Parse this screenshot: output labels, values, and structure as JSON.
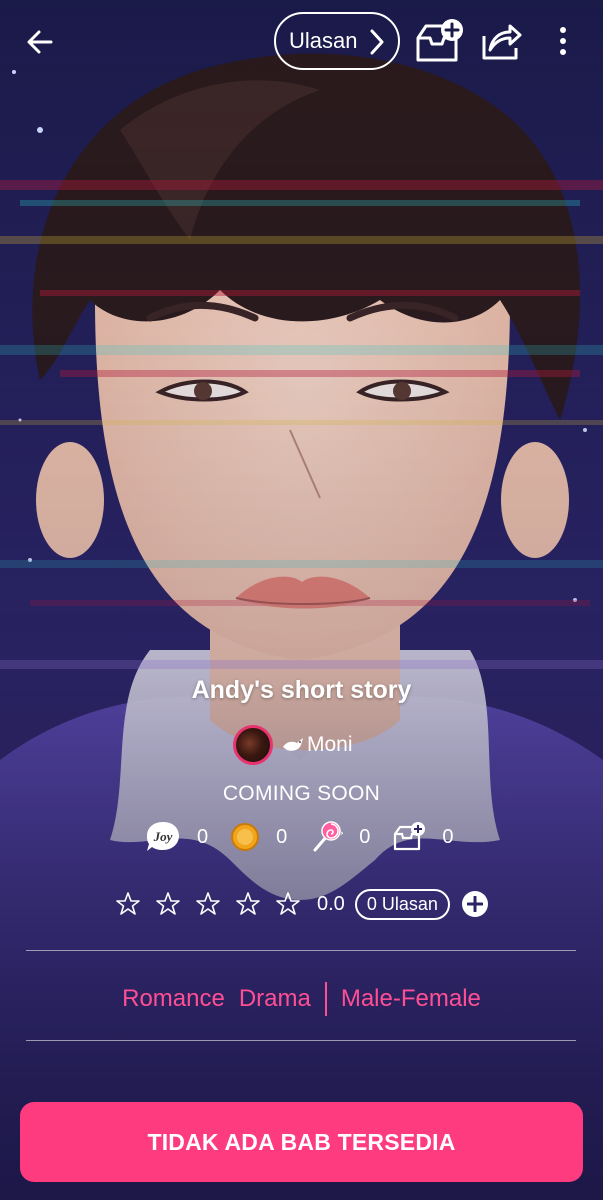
{
  "header": {
    "back_icon": "arrow-left-icon",
    "review_label": "Ulasan",
    "review_icon": "chevron-right-icon",
    "library_icon": "library-add-icon",
    "share_icon": "share-icon",
    "more_icon": "more-vertical-icon"
  },
  "story": {
    "title": "Andy's short story",
    "author": "Moni",
    "author_icon": "dove-icon",
    "status": "COMING SOON"
  },
  "stats": [
    {
      "icon": "joy-icon",
      "value": "0"
    },
    {
      "icon": "coin-icon",
      "value": "0"
    },
    {
      "icon": "lollipop-icon",
      "value": "0"
    },
    {
      "icon": "library-icon",
      "value": "0"
    }
  ],
  "rating": {
    "value": "0.0",
    "reviews": "0 Ulasan",
    "star_icon": "star-outline-icon",
    "add_icon": "plus-circle-icon"
  },
  "genres": [
    "Romance",
    "Drama",
    "Male-Female"
  ],
  "cta": {
    "label": "TIDAK ADA BAB TERSEDIA"
  },
  "colors": {
    "accent": "#ff3b80",
    "genre": "#ff4f94",
    "avatar_ring": "#e8336f"
  }
}
